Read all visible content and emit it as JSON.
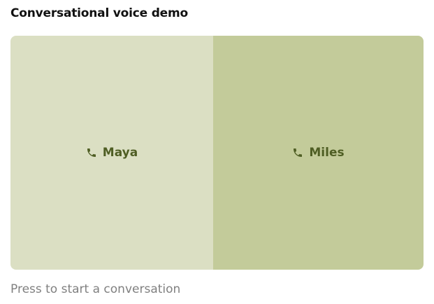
{
  "page": {
    "title": "Conversational voice demo",
    "hint": "Press to start a conversation"
  },
  "voices": [
    {
      "label": "Maya",
      "icon": "phone-icon",
      "background": "#dbdfc3"
    },
    {
      "label": "Miles",
      "icon": "phone-icon",
      "background": "#c3cb9a"
    }
  ],
  "colors": {
    "label_text": "#4f5e24",
    "hint_text": "#808080",
    "title_text": "#111111"
  }
}
